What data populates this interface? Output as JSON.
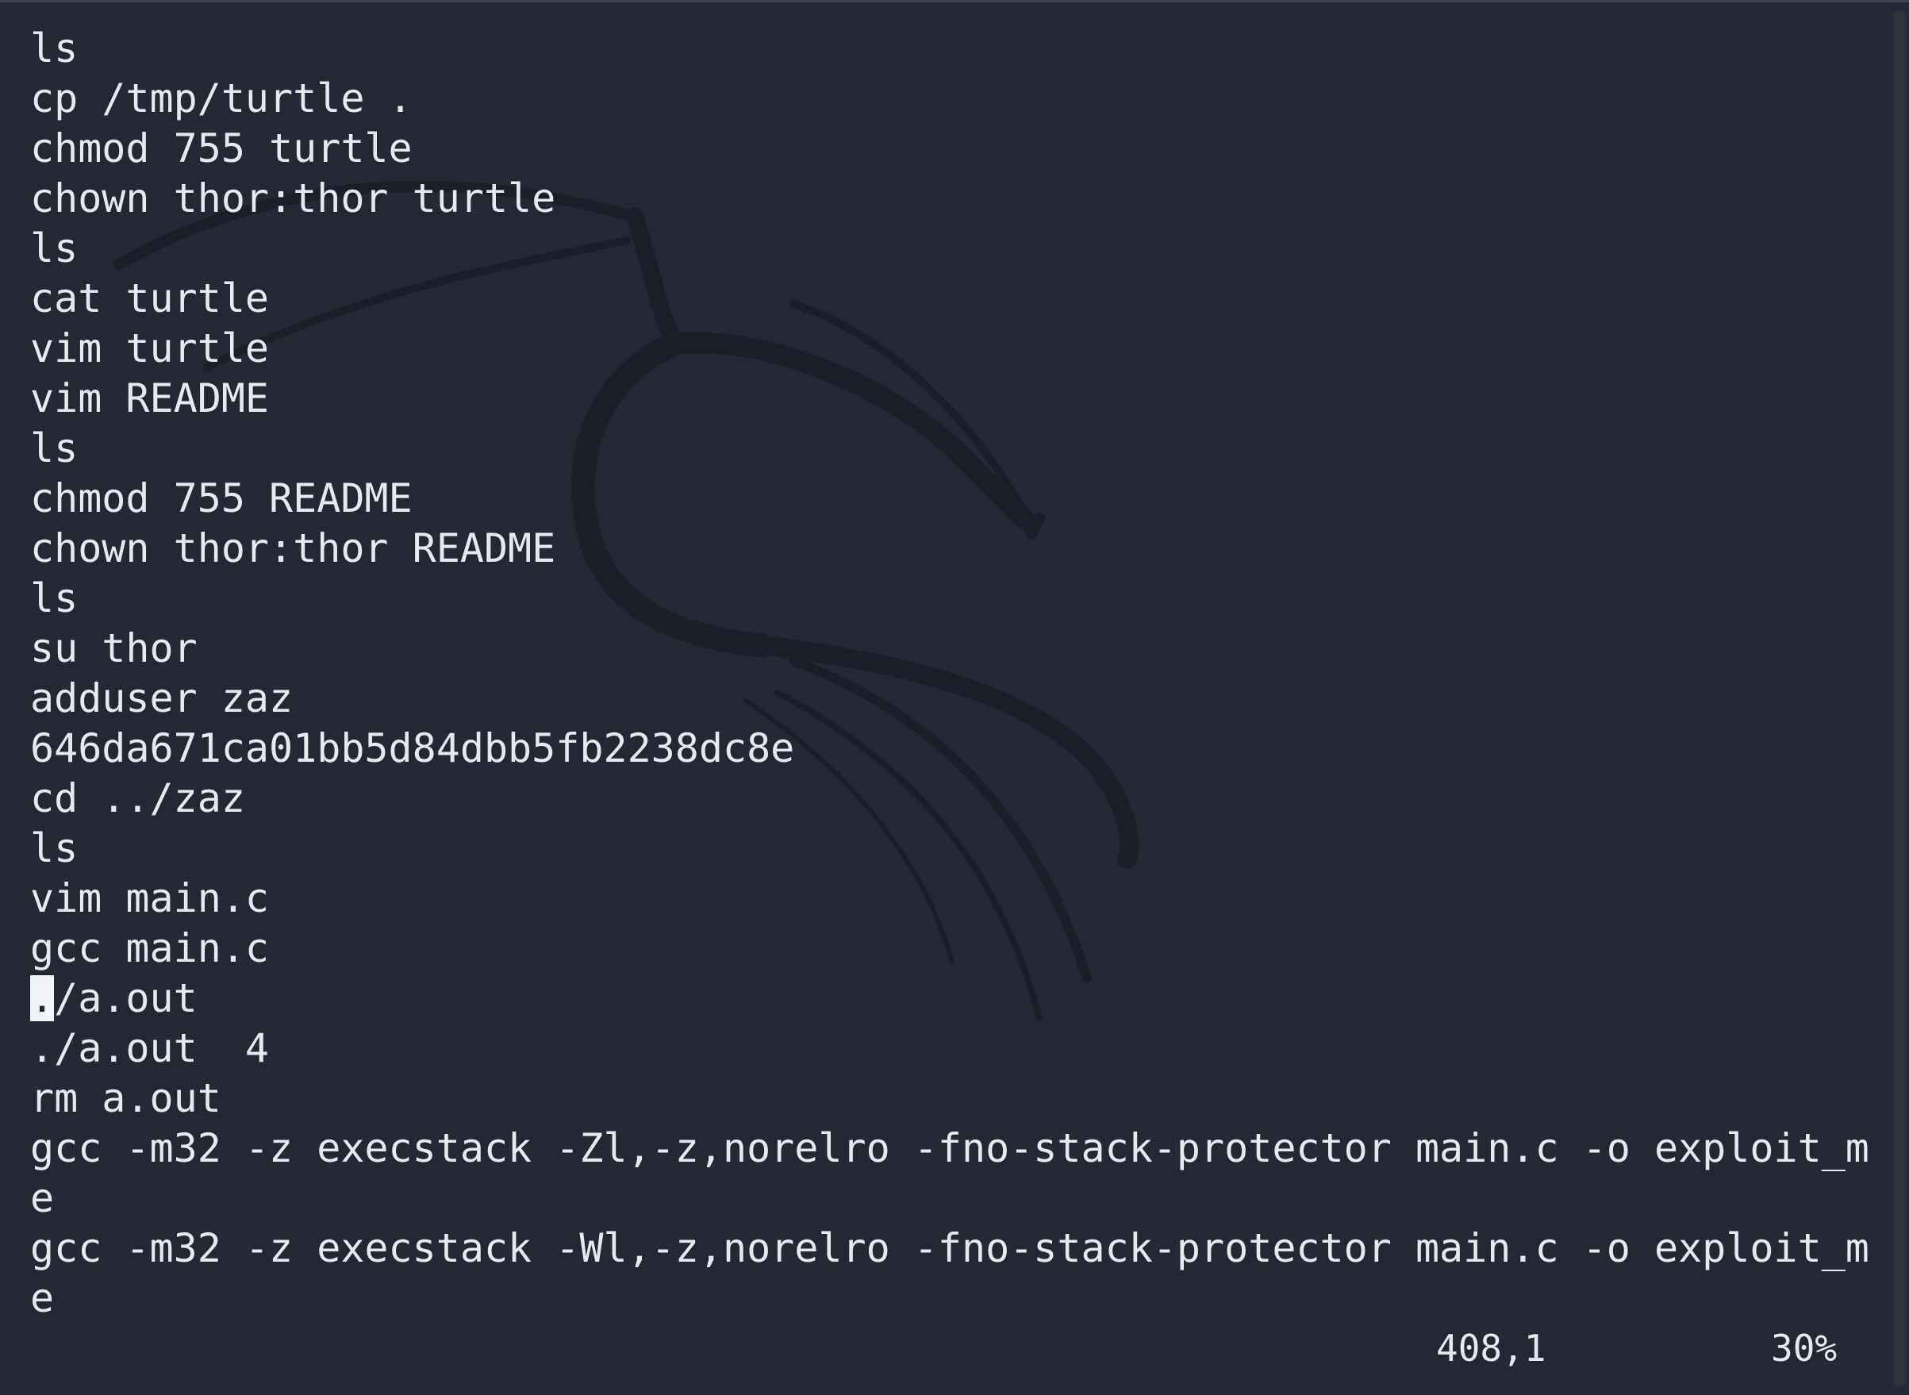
{
  "history_lines": [
    {
      "before": "",
      "cursor": "",
      "after": "ls"
    },
    {
      "before": "",
      "cursor": "",
      "after": "cp /tmp/turtle ."
    },
    {
      "before": "",
      "cursor": "",
      "after": "chmod 755 turtle"
    },
    {
      "before": "",
      "cursor": "",
      "after": "chown thor:thor turtle"
    },
    {
      "before": "",
      "cursor": "",
      "after": "ls"
    },
    {
      "before": "",
      "cursor": "",
      "after": "cat turtle"
    },
    {
      "before": "",
      "cursor": "",
      "after": "vim turtle"
    },
    {
      "before": "",
      "cursor": "",
      "after": "vim README"
    },
    {
      "before": "",
      "cursor": "",
      "after": "ls"
    },
    {
      "before": "",
      "cursor": "",
      "after": "chmod 755 README"
    },
    {
      "before": "",
      "cursor": "",
      "after": "chown thor:thor README"
    },
    {
      "before": "",
      "cursor": "",
      "after": "ls"
    },
    {
      "before": "",
      "cursor": "",
      "after": "su thor"
    },
    {
      "before": "",
      "cursor": "",
      "after": "adduser zaz"
    },
    {
      "before": "",
      "cursor": "",
      "after": "646da671ca01bb5d84dbb5fb2238dc8e"
    },
    {
      "before": "",
      "cursor": "",
      "after": "cd ../zaz"
    },
    {
      "before": "",
      "cursor": "",
      "after": "ls"
    },
    {
      "before": "",
      "cursor": "",
      "after": "vim main.c"
    },
    {
      "before": "",
      "cursor": "",
      "after": "gcc main.c"
    },
    {
      "before": "",
      "cursor": ".",
      "after": "/a.out"
    },
    {
      "before": "",
      "cursor": "",
      "after": "./a.out  4"
    },
    {
      "before": "",
      "cursor": "",
      "after": "rm a.out"
    },
    {
      "before": "",
      "cursor": "",
      "after": "gcc -m32 -z execstack -Zl,-z,norelro -fno-stack-protector main.c -o exploit_m"
    },
    {
      "before": "",
      "cursor": "",
      "after": "e"
    },
    {
      "before": "",
      "cursor": "",
      "after": "gcc -m32 -z execstack -Wl,-z,norelro -fno-stack-protector main.c -o exploit_m"
    },
    {
      "before": "",
      "cursor": "",
      "after": "e"
    }
  ],
  "status": {
    "position": "408,1",
    "percent": "30%"
  },
  "colors": {
    "background": "#232834",
    "text": "#e6e9ee",
    "cursor": "#f2f4f7"
  },
  "icons": {
    "wallpaper": "kali-dragon-icon"
  }
}
